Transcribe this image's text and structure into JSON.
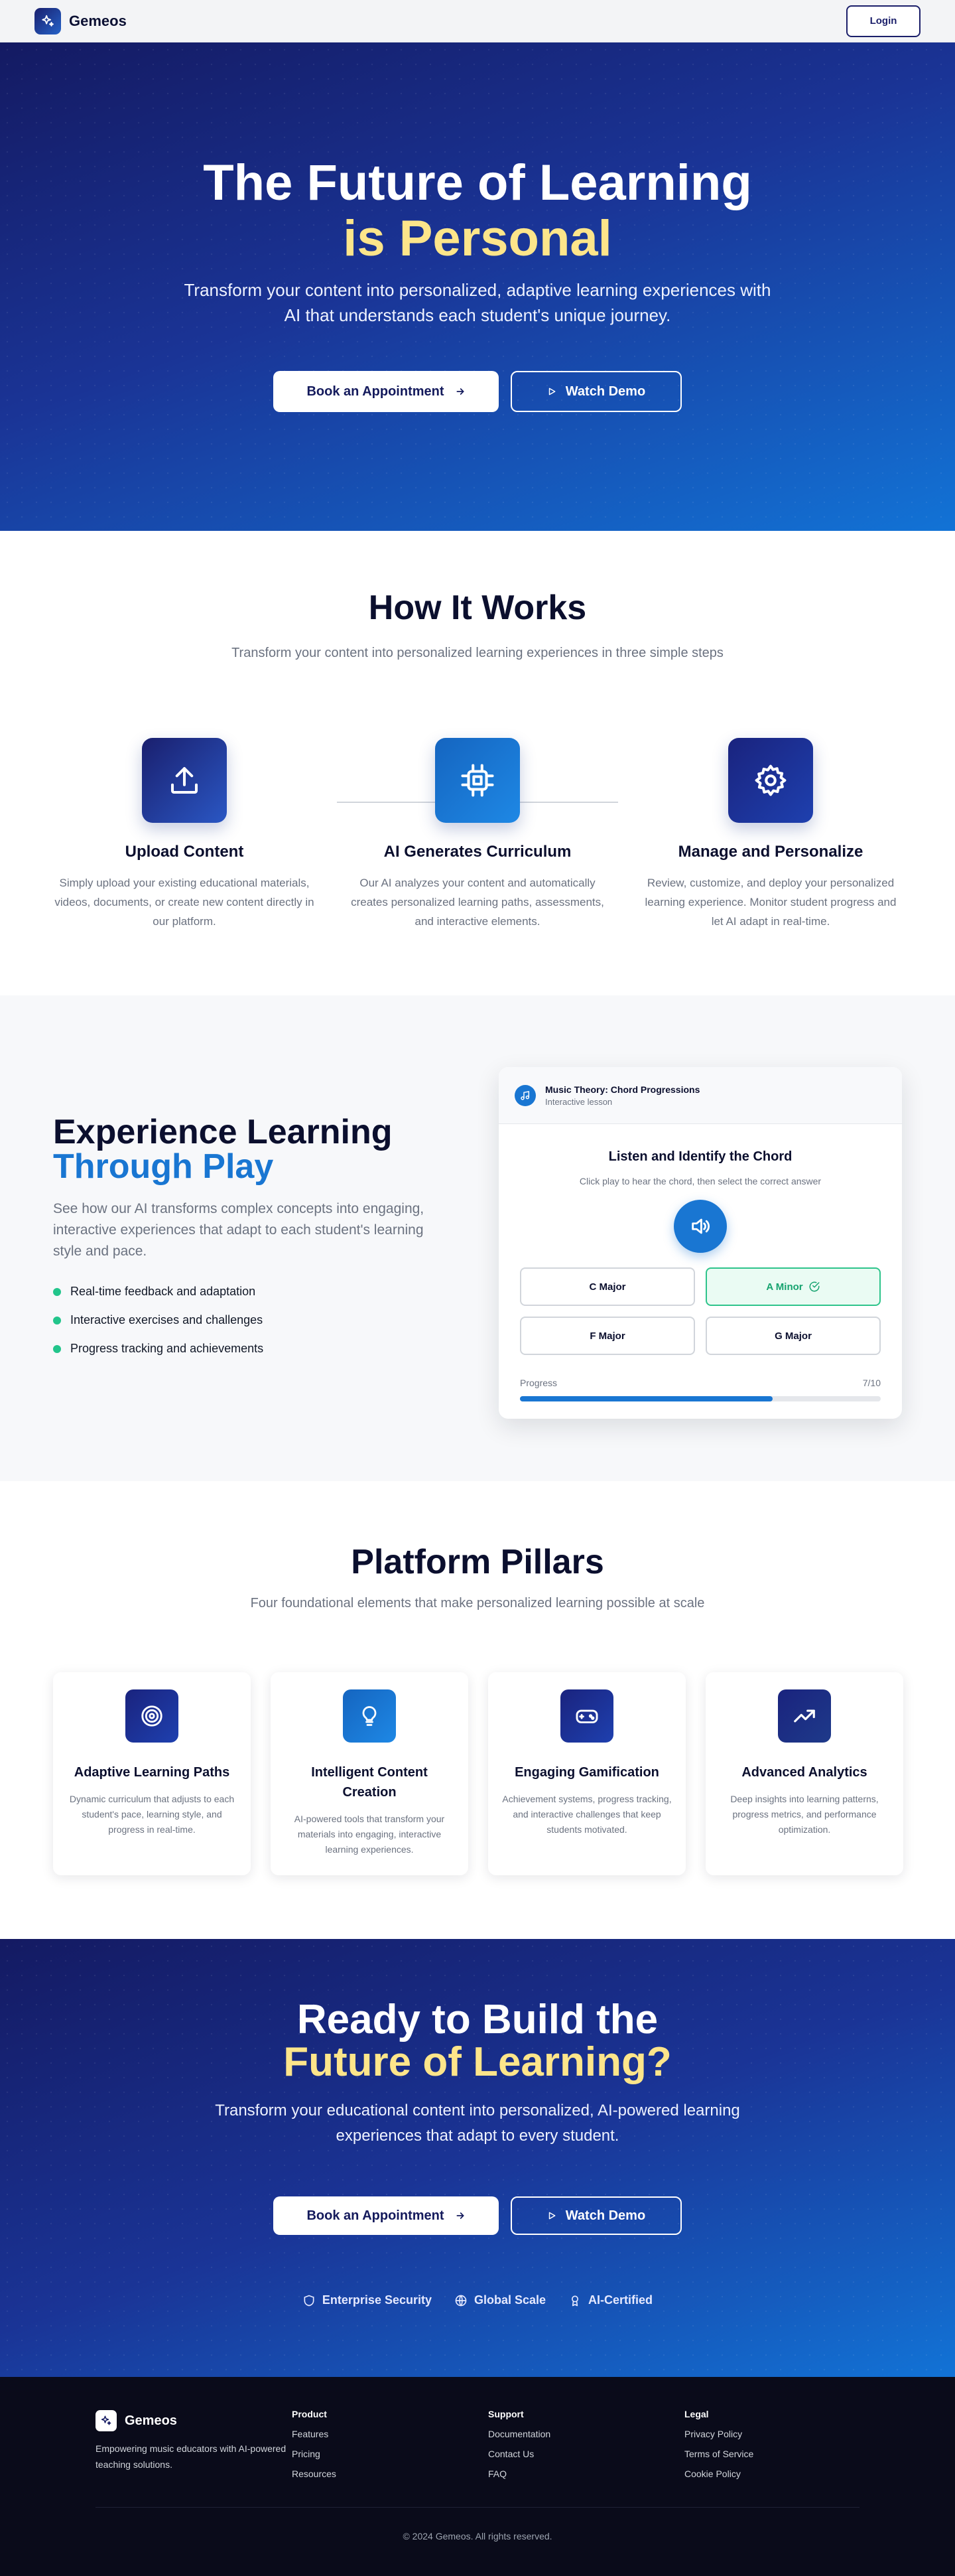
{
  "header": {
    "brand": "Gemeos",
    "login_label": "Login"
  },
  "hero": {
    "title_line1": "The Future of Learning",
    "title_line2": "is Personal",
    "subtitle": "Transform your content into personalized, adaptive learning experiences with AI that understands each student's unique journey.",
    "primary_button": "Book an Appointment",
    "secondary_button": "Watch Demo"
  },
  "how": {
    "title": "How It Works",
    "subtitle": "Transform your content into personalized learning experiences in three simple steps",
    "steps": [
      {
        "title": "Upload Content",
        "text": "Simply upload your existing educational materials, videos, documents, or create new content directly in our platform.",
        "icon": "upload-icon"
      },
      {
        "title": "AI Generates Curriculum",
        "text": "Our AI analyzes your content and automatically creates personalized learning paths, assessments, and interactive elements.",
        "icon": "cpu-icon"
      },
      {
        "title": "Manage and Personalize",
        "text": "Review, customize, and deploy your personalized learning experience. Monitor student progress and let AI adapt in real-time.",
        "icon": "gear-icon"
      }
    ]
  },
  "experience": {
    "title_line1": "Experience Learning",
    "title_line2": "Through Play",
    "description": "See how our AI transforms complex concepts into engaging, interactive experiences that adapt to each student's learning style and pace.",
    "features": [
      "Real-time feedback and adaptation",
      "Interactive exercises and challenges",
      "Progress tracking and achievements"
    ],
    "lesson": {
      "title": "Music Theory: Chord Progressions",
      "subtitle": "Interactive lesson",
      "question": "Listen and Identify the Chord",
      "instruction": "Click play to hear the chord, then select the correct answer",
      "options": [
        "C Major",
        "A Minor",
        "F Major",
        "G Major"
      ],
      "correct_option": "A Minor",
      "progress_label": "Progress",
      "progress_text": "7/10",
      "progress_value": 0.7
    }
  },
  "pillars": {
    "title": "Platform Pillars",
    "subtitle": "Four foundational elements that make personalized learning possible at scale",
    "items": [
      {
        "title": "Adaptive Learning Paths",
        "text": "Dynamic curriculum that adjusts to each student's pace, learning style, and progress in real-time.",
        "icon": "target-icon"
      },
      {
        "title": "Intelligent Content Creation",
        "text": "AI-powered tools that transform your materials into engaging, interactive learning experiences.",
        "icon": "lightbulb-icon"
      },
      {
        "title": "Engaging Gamification",
        "text": "Achievement systems, progress tracking, and interactive challenges that keep students motivated.",
        "icon": "gamepad-icon"
      },
      {
        "title": "Advanced Analytics",
        "text": "Deep insights into learning patterns, progress metrics, and performance optimization.",
        "icon": "trending-up-icon"
      }
    ]
  },
  "cta": {
    "title_line1": "Ready to Build the",
    "title_line2": "Future of Learning?",
    "subtitle": "Transform your educational content into personalized, AI-powered learning experiences that adapt to every student.",
    "primary_button": "Book an Appointment",
    "secondary_button": "Watch Demo",
    "badges": [
      "Enterprise Security",
      "Global Scale",
      "AI-Certified"
    ]
  },
  "footer": {
    "brand": "Gemeos",
    "tagline": "Empowering music educators with AI-powered teaching solutions.",
    "columns": [
      {
        "title": "Product",
        "links": [
          "Features",
          "Pricing",
          "Resources"
        ]
      },
      {
        "title": "Support",
        "links": [
          "Documentation",
          "Contact Us",
          "FAQ"
        ]
      },
      {
        "title": "Legal",
        "links": [
          "Privacy Policy",
          "Terms of Service",
          "Cookie Policy"
        ]
      }
    ],
    "copyright": "© 2024 Gemeos. All rights reserved."
  },
  "colors": {
    "navy": "#141a62",
    "blue": "#1976d2",
    "yellow": "#fde58a",
    "green": "#22c58b",
    "footer_bg": "#0a0b1a"
  }
}
